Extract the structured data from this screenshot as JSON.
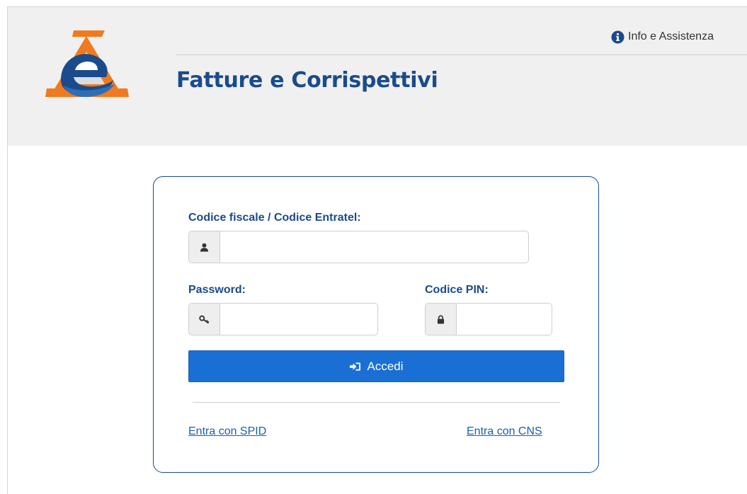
{
  "header": {
    "title": "Fatture e Corrispettivi",
    "info_link": "Info e Assistenza"
  },
  "login": {
    "codice_fiscale_label": "Codice fiscale / Codice Entratel:",
    "codice_fiscale_value": "",
    "password_label": "Password:",
    "password_value": "",
    "pin_label": "Codice PIN:",
    "pin_value": "",
    "submit_label": "Accedi",
    "spid_link": "Entra con SPID",
    "cns_link": "Entra con CNS"
  },
  "colors": {
    "brand_blue": "#1a4b8c",
    "button_blue": "#1a6fd4",
    "logo_orange": "#f07a1e",
    "header_bg": "#f0f0f0"
  },
  "icons": {
    "logo": "agenzia-entrate-logo",
    "info": "info-circle-icon",
    "user": "user-icon",
    "key": "key-icon",
    "lock": "lock-icon",
    "sign_in": "sign-in-icon"
  }
}
